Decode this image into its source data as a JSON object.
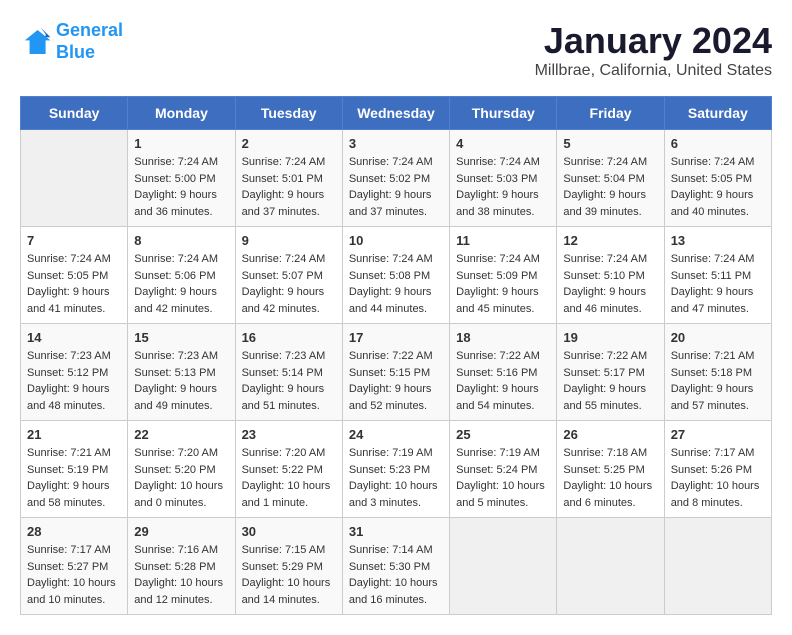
{
  "header": {
    "logo_line1": "General",
    "logo_line2": "Blue",
    "title": "January 2024",
    "subtitle": "Millbrae, California, United States"
  },
  "columns": [
    "Sunday",
    "Monday",
    "Tuesday",
    "Wednesday",
    "Thursday",
    "Friday",
    "Saturday"
  ],
  "weeks": [
    [
      {
        "day": "",
        "info": ""
      },
      {
        "day": "1",
        "info": "Sunrise: 7:24 AM\nSunset: 5:00 PM\nDaylight: 9 hours\nand 36 minutes."
      },
      {
        "day": "2",
        "info": "Sunrise: 7:24 AM\nSunset: 5:01 PM\nDaylight: 9 hours\nand 37 minutes."
      },
      {
        "day": "3",
        "info": "Sunrise: 7:24 AM\nSunset: 5:02 PM\nDaylight: 9 hours\nand 37 minutes."
      },
      {
        "day": "4",
        "info": "Sunrise: 7:24 AM\nSunset: 5:03 PM\nDaylight: 9 hours\nand 38 minutes."
      },
      {
        "day": "5",
        "info": "Sunrise: 7:24 AM\nSunset: 5:04 PM\nDaylight: 9 hours\nand 39 minutes."
      },
      {
        "day": "6",
        "info": "Sunrise: 7:24 AM\nSunset: 5:05 PM\nDaylight: 9 hours\nand 40 minutes."
      }
    ],
    [
      {
        "day": "7",
        "info": "Sunrise: 7:24 AM\nSunset: 5:05 PM\nDaylight: 9 hours\nand 41 minutes."
      },
      {
        "day": "8",
        "info": "Sunrise: 7:24 AM\nSunset: 5:06 PM\nDaylight: 9 hours\nand 42 minutes."
      },
      {
        "day": "9",
        "info": "Sunrise: 7:24 AM\nSunset: 5:07 PM\nDaylight: 9 hours\nand 42 minutes."
      },
      {
        "day": "10",
        "info": "Sunrise: 7:24 AM\nSunset: 5:08 PM\nDaylight: 9 hours\nand 44 minutes."
      },
      {
        "day": "11",
        "info": "Sunrise: 7:24 AM\nSunset: 5:09 PM\nDaylight: 9 hours\nand 45 minutes."
      },
      {
        "day": "12",
        "info": "Sunrise: 7:24 AM\nSunset: 5:10 PM\nDaylight: 9 hours\nand 46 minutes."
      },
      {
        "day": "13",
        "info": "Sunrise: 7:24 AM\nSunset: 5:11 PM\nDaylight: 9 hours\nand 47 minutes."
      }
    ],
    [
      {
        "day": "14",
        "info": "Sunrise: 7:23 AM\nSunset: 5:12 PM\nDaylight: 9 hours\nand 48 minutes."
      },
      {
        "day": "15",
        "info": "Sunrise: 7:23 AM\nSunset: 5:13 PM\nDaylight: 9 hours\nand 49 minutes."
      },
      {
        "day": "16",
        "info": "Sunrise: 7:23 AM\nSunset: 5:14 PM\nDaylight: 9 hours\nand 51 minutes."
      },
      {
        "day": "17",
        "info": "Sunrise: 7:22 AM\nSunset: 5:15 PM\nDaylight: 9 hours\nand 52 minutes."
      },
      {
        "day": "18",
        "info": "Sunrise: 7:22 AM\nSunset: 5:16 PM\nDaylight: 9 hours\nand 54 minutes."
      },
      {
        "day": "19",
        "info": "Sunrise: 7:22 AM\nSunset: 5:17 PM\nDaylight: 9 hours\nand 55 minutes."
      },
      {
        "day": "20",
        "info": "Sunrise: 7:21 AM\nSunset: 5:18 PM\nDaylight: 9 hours\nand 57 minutes."
      }
    ],
    [
      {
        "day": "21",
        "info": "Sunrise: 7:21 AM\nSunset: 5:19 PM\nDaylight: 9 hours\nand 58 minutes."
      },
      {
        "day": "22",
        "info": "Sunrise: 7:20 AM\nSunset: 5:20 PM\nDaylight: 10 hours\nand 0 minutes."
      },
      {
        "day": "23",
        "info": "Sunrise: 7:20 AM\nSunset: 5:22 PM\nDaylight: 10 hours\nand 1 minute."
      },
      {
        "day": "24",
        "info": "Sunrise: 7:19 AM\nSunset: 5:23 PM\nDaylight: 10 hours\nand 3 minutes."
      },
      {
        "day": "25",
        "info": "Sunrise: 7:19 AM\nSunset: 5:24 PM\nDaylight: 10 hours\nand 5 minutes."
      },
      {
        "day": "26",
        "info": "Sunrise: 7:18 AM\nSunset: 5:25 PM\nDaylight: 10 hours\nand 6 minutes."
      },
      {
        "day": "27",
        "info": "Sunrise: 7:17 AM\nSunset: 5:26 PM\nDaylight: 10 hours\nand 8 minutes."
      }
    ],
    [
      {
        "day": "28",
        "info": "Sunrise: 7:17 AM\nSunset: 5:27 PM\nDaylight: 10 hours\nand 10 minutes."
      },
      {
        "day": "29",
        "info": "Sunrise: 7:16 AM\nSunset: 5:28 PM\nDaylight: 10 hours\nand 12 minutes."
      },
      {
        "day": "30",
        "info": "Sunrise: 7:15 AM\nSunset: 5:29 PM\nDaylight: 10 hours\nand 14 minutes."
      },
      {
        "day": "31",
        "info": "Sunrise: 7:14 AM\nSunset: 5:30 PM\nDaylight: 10 hours\nand 16 minutes."
      },
      {
        "day": "",
        "info": ""
      },
      {
        "day": "",
        "info": ""
      },
      {
        "day": "",
        "info": ""
      }
    ]
  ]
}
